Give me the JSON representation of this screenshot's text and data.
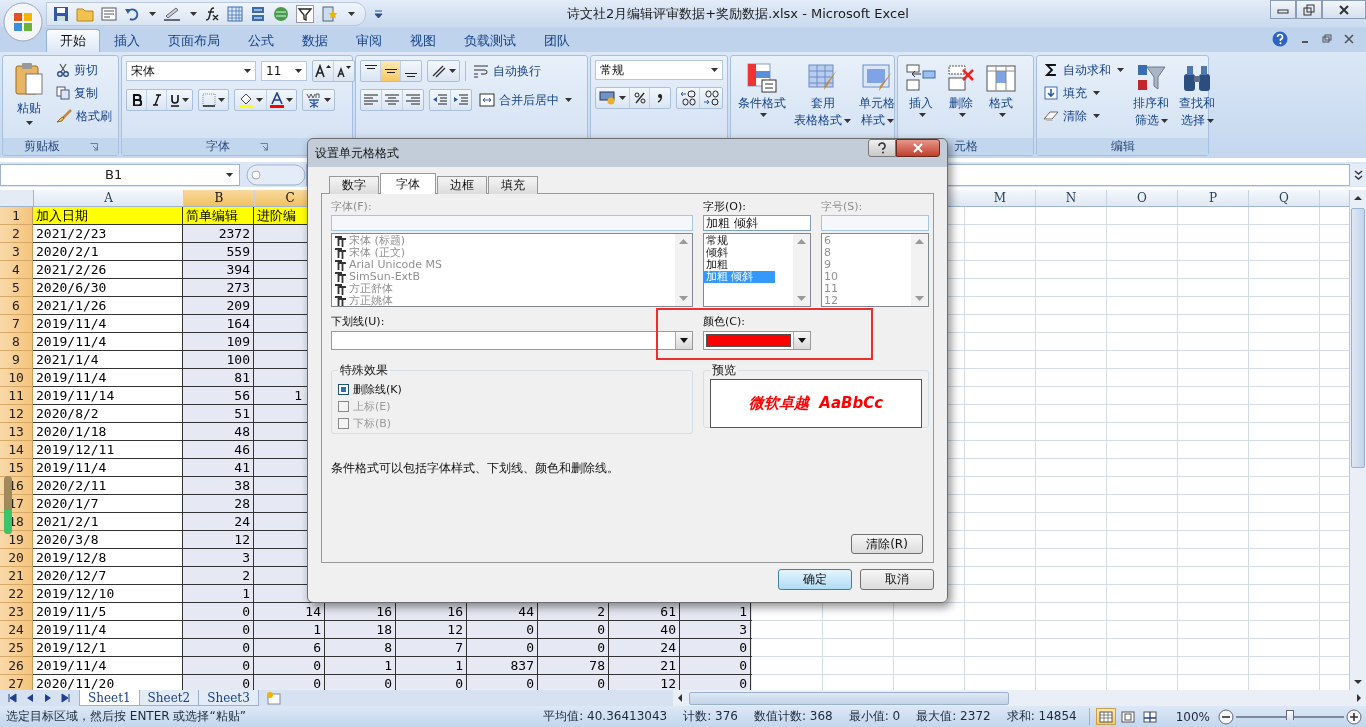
{
  "window": {
    "title": "诗文社2月编辑评审数据+奖励数据.xlsx - Microsoft Excel"
  },
  "ribbon_tabs": [
    {
      "label": "开始",
      "selected": true
    },
    {
      "label": "插入",
      "selected": false
    },
    {
      "label": "页面布局",
      "selected": false
    },
    {
      "label": "公式",
      "selected": false
    },
    {
      "label": "数据",
      "selected": false
    },
    {
      "label": "审阅",
      "selected": false
    },
    {
      "label": "视图",
      "selected": false
    },
    {
      "label": "负载测试",
      "selected": false
    },
    {
      "label": "团队",
      "selected": false
    }
  ],
  "clipboard": {
    "paste": "粘贴",
    "cut": "剪切",
    "copy": "复制",
    "format_painter": "格式刷",
    "label": "剪贴板"
  },
  "font_group": {
    "font_name": "宋体",
    "font_size": "11",
    "label": "字体"
  },
  "alignment": {
    "vertical": [
      {
        "selected": false
      },
      {
        "selected": true
      },
      {
        "selected": false
      }
    ],
    "wrap_text": "自动换行",
    "merge_center": "合并后居中"
  },
  "number": {
    "format": "常规"
  },
  "styles": [
    {
      "kind": "conditional",
      "lines": [
        "条件格式"
      ]
    },
    {
      "kind": "table",
      "lines": [
        "套用",
        "表格格式"
      ]
    },
    {
      "kind": "cellstyle",
      "lines": [
        "单元格",
        "样式"
      ]
    }
  ],
  "cells_group": {
    "buttons": [
      {
        "kind": "insert",
        "label": "插入"
      },
      {
        "kind": "delete",
        "label": "删除"
      },
      {
        "kind": "format",
        "label": "格式"
      }
    ],
    "label": "元格"
  },
  "editing": {
    "small": [
      {
        "kind": "sum",
        "label": "自动求和"
      },
      {
        "kind": "fill",
        "label": "填充"
      },
      {
        "kind": "clear",
        "label": "清除"
      }
    ],
    "big": [
      {
        "kind": "sort",
        "lines": [
          "排序和",
          "筛选"
        ]
      },
      {
        "kind": "find",
        "lines": [
          "查找和",
          "选择"
        ]
      }
    ],
    "label": "编辑"
  },
  "formula_bar": {
    "name_box": "B1"
  },
  "column_headers": [
    {
      "label": "A",
      "selected": false
    },
    {
      "label": "B",
      "selected": true
    },
    {
      "label": "C",
      "selected": true
    },
    {
      "label": "M",
      "selected": false
    },
    {
      "label": "N",
      "selected": false
    },
    {
      "label": "O",
      "selected": false
    },
    {
      "label": "P",
      "selected": false
    },
    {
      "label": "Q",
      "selected": false
    }
  ],
  "rows": [
    {
      "number": "1",
      "kind": "header",
      "cells": [
        "加入日期",
        "简单编辑",
        "进阶编"
      ]
    },
    {
      "number": "2",
      "kind": "data",
      "cells": [
        "2021/2/23",
        "2372"
      ]
    },
    {
      "number": "3",
      "kind": "data",
      "cells": [
        "2020/2/1",
        "559"
      ]
    },
    {
      "number": "4",
      "kind": "data",
      "cells": [
        "2021/2/26",
        "394"
      ]
    },
    {
      "number": "5",
      "kind": "data",
      "cells": [
        "2020/6/30",
        "273"
      ]
    },
    {
      "number": "6",
      "kind": "data",
      "cells": [
        "2021/1/26",
        "209"
      ]
    },
    {
      "number": "7",
      "kind": "data",
      "cells": [
        "2019/11/4",
        "164"
      ]
    },
    {
      "number": "8",
      "kind": "data",
      "cells": [
        "2019/11/4",
        "109"
      ]
    },
    {
      "number": "9",
      "kind": "data",
      "cells": [
        "2021/1/4",
        "100"
      ]
    },
    {
      "number": "10",
      "kind": "data",
      "cells": [
        "2019/11/4",
        "81"
      ]
    },
    {
      "number": "11",
      "kind": "data",
      "cells": [
        "2019/11/14",
        "56",
        "1"
      ]
    },
    {
      "number": "12",
      "kind": "data",
      "cells": [
        "2020/8/2",
        "51"
      ]
    },
    {
      "number": "13",
      "kind": "data",
      "cells": [
        "2020/1/18",
        "48"
      ]
    },
    {
      "number": "14",
      "kind": "data",
      "cells": [
        "2019/12/11",
        "46"
      ]
    },
    {
      "number": "15",
      "kind": "data",
      "cells": [
        "2019/11/4",
        "41"
      ]
    },
    {
      "number": "16",
      "kind": "data",
      "cells": [
        "2020/2/11",
        "38"
      ]
    },
    {
      "number": "17",
      "kind": "data",
      "cells": [
        "2020/1/7",
        "28"
      ]
    },
    {
      "number": "18",
      "kind": "data",
      "cells": [
        "2021/2/1",
        "24"
      ]
    },
    {
      "number": "19",
      "kind": "data",
      "cells": [
        "2020/3/8",
        "12"
      ]
    },
    {
      "number": "20",
      "kind": "data",
      "cells": [
        "2019/12/8",
        "3"
      ]
    },
    {
      "number": "21",
      "kind": "data",
      "cells": [
        "2020/12/7",
        "2"
      ]
    },
    {
      "number": "22",
      "kind": "data",
      "cells": [
        "2019/12/10",
        "1"
      ]
    },
    {
      "number": "23",
      "kind": "data",
      "cells": [
        "2019/11/5",
        "0",
        "14",
        "16",
        "16",
        "44",
        "2",
        "61",
        "1"
      ]
    },
    {
      "number": "24",
      "kind": "data",
      "cells": [
        "2019/11/4",
        "0",
        "1",
        "18",
        "12",
        "0",
        "0",
        "40",
        "3"
      ]
    },
    {
      "number": "25",
      "kind": "data",
      "cells": [
        "2019/12/1",
        "0",
        "6",
        "8",
        "7",
        "0",
        "0",
        "24",
        "0"
      ]
    },
    {
      "number": "26",
      "kind": "data",
      "cells": [
        "2019/11/4",
        "0",
        "0",
        "1",
        "1",
        "837",
        "78",
        "21",
        "0"
      ]
    },
    {
      "number": "27",
      "kind": "data",
      "cells": [
        "2020/11/20",
        "0",
        "0",
        "0",
        "0",
        "0",
        "0",
        "12",
        "0"
      ]
    }
  ],
  "sheet_tabs": [
    {
      "label": "Sheet1",
      "selected": true
    },
    {
      "label": "Sheet2",
      "selected": false
    },
    {
      "label": "Sheet3",
      "selected": false
    }
  ],
  "status_bar": {
    "message": "选定目标区域，然后按 ENTER 或选择“粘贴”",
    "stats": [
      "平均值: 40.36413043",
      "计数: 376",
      "数值计数: 368",
      "最小值: 0",
      "最大值: 2372",
      "求和: 14854"
    ],
    "views": [
      {
        "selected": true
      },
      {
        "selected": false
      },
      {
        "selected": false
      }
    ],
    "zoom": "100%",
    "zoom_slider": {
      "level": 0.5
    }
  },
  "dialog": {
    "title": "设置单元格格式",
    "tabs": [
      {
        "label": "数字",
        "selected": false
      },
      {
        "label": "字体",
        "selected": true
      },
      {
        "label": "边框",
        "selected": false
      },
      {
        "label": "填充",
        "selected": false
      }
    ],
    "font": {
      "label": "字体(F):",
      "disabled": true,
      "items": [
        "宋体 (标题)",
        "宋体 (正文)",
        "Arial Unicode MS",
        "SimSun-ExtB",
        "方正舒体",
        "方正姚体"
      ]
    },
    "style": {
      "label": "字形(O):",
      "value": "加粗 倾斜",
      "items": [
        {
          "label": "常规",
          "selected": false
        },
        {
          "label": "倾斜",
          "selected": false
        },
        {
          "label": "加粗",
          "selected": false
        },
        {
          "label": "加粗 倾斜",
          "selected": true
        }
      ]
    },
    "size": {
      "label": "字号(S):",
      "disabled": true,
      "items": [
        "6",
        "8",
        "9",
        "10",
        "11",
        "12"
      ]
    },
    "underline": {
      "label": "下划线(U):"
    },
    "color": {
      "label": "颜色(C):",
      "color": "#ff0000"
    },
    "effects": {
      "label": "特殊效果",
      "options": [
        {
          "label": "删除线(K)",
          "checked": true,
          "disabled": false
        },
        {
          "label": "上标(E)",
          "checked": false,
          "disabled": true
        },
        {
          "label": "下标(B)",
          "checked": false,
          "disabled": true
        }
      ]
    },
    "preview": {
      "label": "预览",
      "sample": "微软卓越  AaBbCc"
    },
    "note": "条件格式可以包括字体样式、下划线、颜色和删除线。",
    "buttons": {
      "clear": "清除(R)",
      "ok": "确定",
      "cancel": "取消"
    }
  }
}
